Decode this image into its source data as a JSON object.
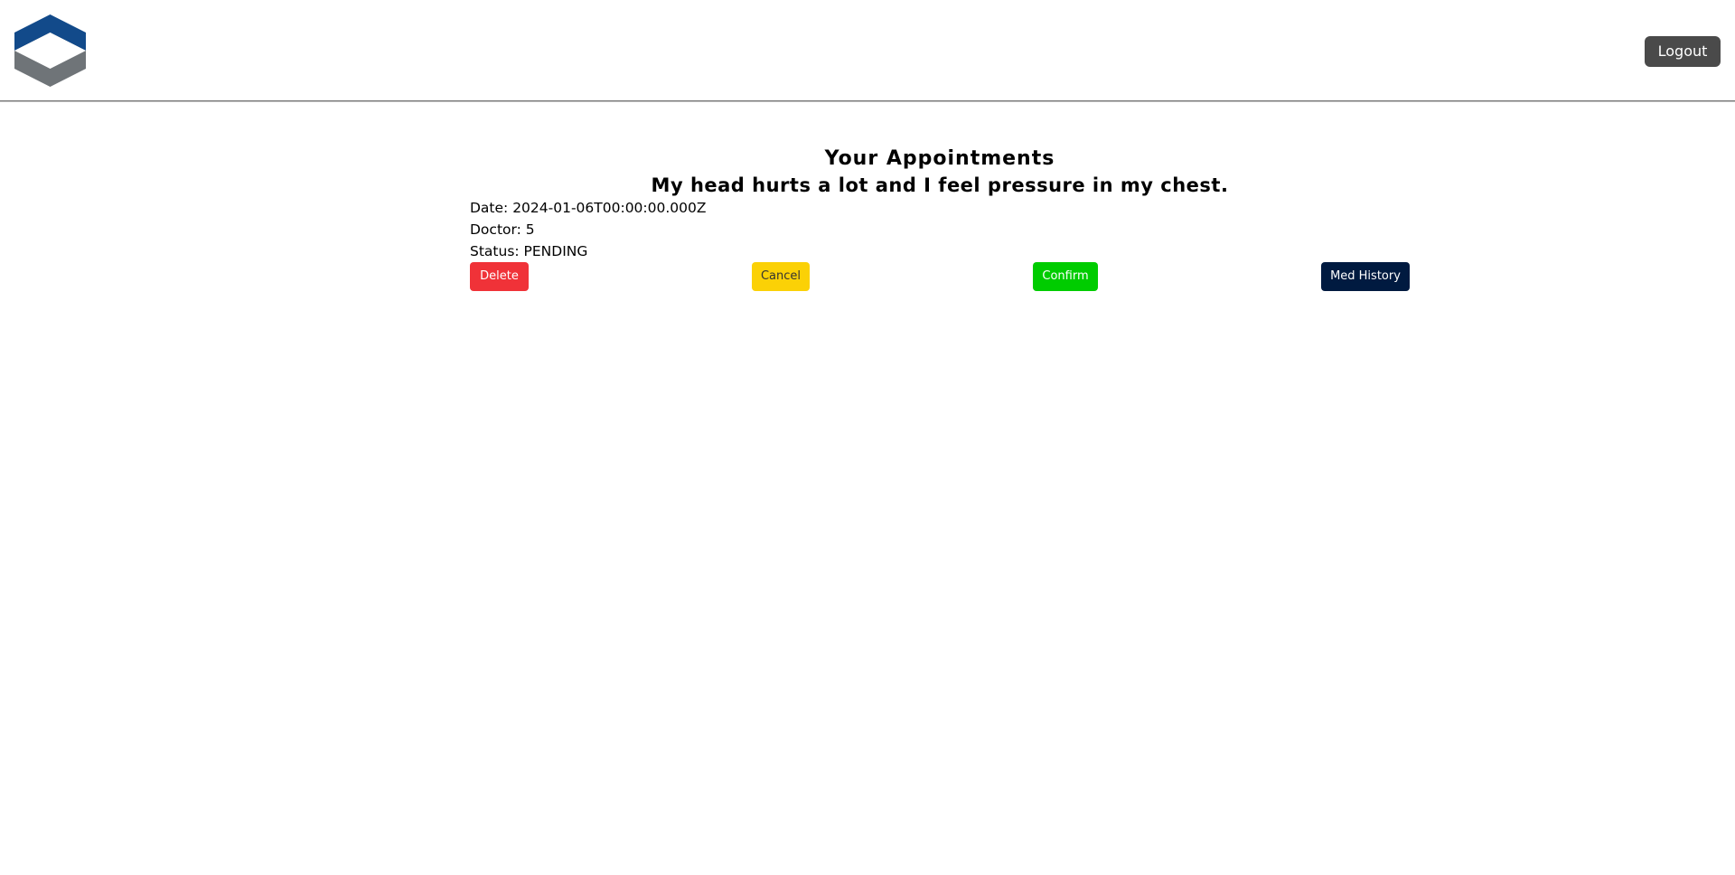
{
  "header": {
    "logout_label": "Logout"
  },
  "main": {
    "title": "Your Appointments",
    "appointments": [
      {
        "reason": "My head hurts a lot and I feel pressure in my chest.",
        "date": "Date: 2024-01-06T00:00:00.000Z",
        "doctor": "Doctor: 5",
        "status": "Status: PENDING",
        "actions": {
          "delete_label": "Delete",
          "cancel_label": "Cancel",
          "confirm_label": "Confirm",
          "history_label": "Med History"
        }
      }
    ]
  },
  "colors": {
    "logo_top": "#124a8a",
    "logo_bottom": "#6f7478",
    "logout_bg": "#4a4a4a",
    "delete": "#f03238",
    "cancel": "#fbd106",
    "confirm": "#00cc00",
    "med_history": "#001a40"
  },
  "icons": {
    "logo": "hexagon-diamond-logo"
  }
}
